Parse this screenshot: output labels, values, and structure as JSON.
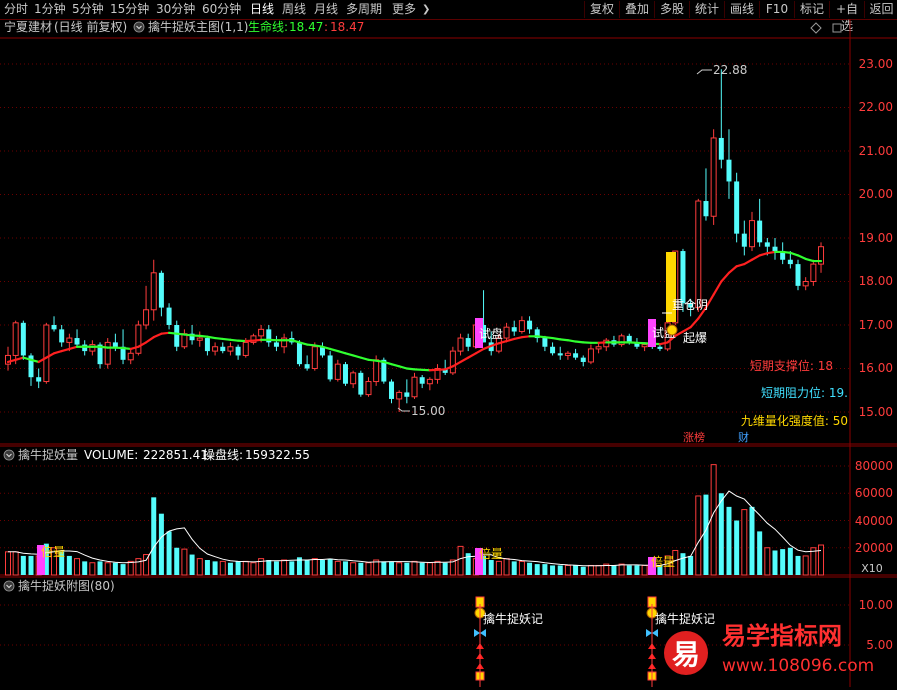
{
  "toolbar": {
    "periods": [
      "分时",
      "1分钟",
      "5分钟",
      "15分钟",
      "30分钟",
      "60分钟",
      "日线",
      "周线",
      "月线",
      "多周期",
      "更多"
    ],
    "active_period": "日线",
    "more_arrow": "❯",
    "buttons": [
      "复权",
      "叠加",
      "多股",
      "统计",
      "画线",
      "F10",
      "标记",
      "+自选",
      "返回"
    ]
  },
  "main_panel": {
    "stock_name": "宁夏建材",
    "period_desc": "(日线 前复权)",
    "indicator_name": "擒牛捉妖主图(1,1)",
    "life_line_label": "生命线:",
    "life_line_value_1": "18.47",
    "life_line_value_2": "18.47",
    "high_label": "22.88",
    "low_label": "15.00",
    "right_labels": [
      {
        "text": "短期支撑位:  18",
        "color": "#ff3c3c"
      },
      {
        "text": "短期阻力位:  19.",
        "color": "#40e0ff"
      },
      {
        "text": "九维量化强度值:  50",
        "color": "#ffd700"
      }
    ],
    "annotations": [
      "试盘",
      "试盘",
      "重仓阴",
      "起爆"
    ],
    "tags": [
      "涨榜",
      "财"
    ],
    "y_ticks": [
      "23.00",
      "22.00",
      "21.00",
      "20.00",
      "19.00",
      "18.00",
      "17.00",
      "16.00",
      "15.00"
    ],
    "icons": [
      "diamond-icon",
      "expand-icon"
    ]
  },
  "volume_panel": {
    "title": "擒牛捉妖量",
    "volume_label": "VOLUME:",
    "volume_value": "222851.41",
    "line_label": "操盘线:",
    "line_value": "159322.55",
    "y_ticks": [
      "80000",
      "60000",
      "40000",
      "20000"
    ],
    "unit": "X10",
    "markers": [
      "倍量",
      "倍量",
      "倍量"
    ]
  },
  "sub_panel": {
    "title": "擒牛捉妖附图(80)",
    "y_ticks": [
      "10.00",
      "5.00"
    ],
    "labels": [
      "擒牛捉妖记",
      "擒牛捉妖记"
    ]
  },
  "watermark": {
    "brand": "易学指标网",
    "url": "www.108096.com",
    "logo_char": "易"
  },
  "colors": {
    "up": "#ff3c3c",
    "down": "#54fcfc",
    "grid": "#8b0000",
    "life_up": "#ff2020",
    "life_down": "#30ff30",
    "highlight": "#ff44ff",
    "gold": "#ffd700"
  },
  "chart_data": {
    "type": "candlestick",
    "price_ylim": [
      14.6,
      23.4
    ],
    "volume_ylim": [
      0,
      90000
    ],
    "candles": [
      [
        16.1,
        16.5,
        15.95,
        16.3
      ],
      [
        16.3,
        17.1,
        16.1,
        17.05
      ],
      [
        17.05,
        17.1,
        16.2,
        16.3
      ],
      [
        16.3,
        16.35,
        15.6,
        15.8
      ],
      [
        15.8,
        16.0,
        15.55,
        15.7
      ],
      [
        15.7,
        17.05,
        15.65,
        17.0
      ],
      [
        17.0,
        17.2,
        16.85,
        16.9
      ],
      [
        16.9,
        17.0,
        16.5,
        16.6
      ],
      [
        16.6,
        16.8,
        16.4,
        16.7
      ],
      [
        16.7,
        16.9,
        16.5,
        16.55
      ],
      [
        16.55,
        16.65,
        16.3,
        16.4
      ],
      [
        16.4,
        16.65,
        16.3,
        16.55
      ],
      [
        16.55,
        16.6,
        16.0,
        16.1
      ],
      [
        16.1,
        16.7,
        16.0,
        16.6
      ],
      [
        16.6,
        16.8,
        16.4,
        16.5
      ],
      [
        16.5,
        16.9,
        16.1,
        16.2
      ],
      [
        16.2,
        16.45,
        16.1,
        16.35
      ],
      [
        16.35,
        17.1,
        16.3,
        17.0
      ],
      [
        17.0,
        17.9,
        16.9,
        17.35
      ],
      [
        17.35,
        18.5,
        17.1,
        18.2
      ],
      [
        18.2,
        18.25,
        17.2,
        17.4
      ],
      [
        17.4,
        17.5,
        16.9,
        17.0
      ],
      [
        17.0,
        17.1,
        16.4,
        16.5
      ],
      [
        16.5,
        16.9,
        16.45,
        16.8
      ],
      [
        16.8,
        17.0,
        16.55,
        16.65
      ],
      [
        16.65,
        16.85,
        16.5,
        16.7
      ],
      [
        16.7,
        16.75,
        16.3,
        16.4
      ],
      [
        16.4,
        16.6,
        16.3,
        16.5
      ],
      [
        16.5,
        16.6,
        16.35,
        16.4
      ],
      [
        16.4,
        16.6,
        16.3,
        16.5
      ],
      [
        16.5,
        16.55,
        16.2,
        16.3
      ],
      [
        16.3,
        16.7,
        16.25,
        16.6
      ],
      [
        16.6,
        16.8,
        16.55,
        16.75
      ],
      [
        16.75,
        17.0,
        16.6,
        16.9
      ],
      [
        16.9,
        17.0,
        16.5,
        16.6
      ],
      [
        16.6,
        16.75,
        16.4,
        16.5
      ],
      [
        16.5,
        16.8,
        16.35,
        16.7
      ],
      [
        16.7,
        16.85,
        16.55,
        16.6
      ],
      [
        16.6,
        16.65,
        16.05,
        16.1
      ],
      [
        16.1,
        16.3,
        15.95,
        16.0
      ],
      [
        16.0,
        16.6,
        15.95,
        16.5
      ],
      [
        16.5,
        16.6,
        16.25,
        16.3
      ],
      [
        16.3,
        16.4,
        15.7,
        15.75
      ],
      [
        15.75,
        16.2,
        15.7,
        16.1
      ],
      [
        16.1,
        16.15,
        15.6,
        15.65
      ],
      [
        15.65,
        15.95,
        15.55,
        15.9
      ],
      [
        15.9,
        15.95,
        15.35,
        15.4
      ],
      [
        15.4,
        15.8,
        15.35,
        15.7
      ],
      [
        15.7,
        16.3,
        15.6,
        16.2
      ],
      [
        16.2,
        16.25,
        15.65,
        15.7
      ],
      [
        15.7,
        15.75,
        15.2,
        15.3
      ],
      [
        15.3,
        15.5,
        15.0,
        15.45
      ],
      [
        15.45,
        15.75,
        15.2,
        15.35
      ],
      [
        15.35,
        15.9,
        15.3,
        15.8
      ],
      [
        15.8,
        15.85,
        15.55,
        15.65
      ],
      [
        15.65,
        15.8,
        15.5,
        15.75
      ],
      [
        15.75,
        16.1,
        15.65,
        16.0
      ],
      [
        16.0,
        16.2,
        15.85,
        15.9
      ],
      [
        15.9,
        16.5,
        15.85,
        16.4
      ],
      [
        16.4,
        16.8,
        16.3,
        16.7
      ],
      [
        16.7,
        16.8,
        16.4,
        16.5
      ],
      [
        16.5,
        17.1,
        16.45,
        17.0
      ],
      [
        17.0,
        17.8,
        16.6,
        16.6
      ],
      [
        16.6,
        16.85,
        16.3,
        16.4
      ],
      [
        16.4,
        16.8,
        16.35,
        16.7
      ],
      [
        16.7,
        17.05,
        16.6,
        16.95
      ],
      [
        16.95,
        17.1,
        16.75,
        16.85
      ],
      [
        16.85,
        17.2,
        16.8,
        17.1
      ],
      [
        17.1,
        17.2,
        16.8,
        16.9
      ],
      [
        16.9,
        16.95,
        16.6,
        16.7
      ],
      [
        16.7,
        16.75,
        16.4,
        16.5
      ],
      [
        16.5,
        16.6,
        16.3,
        16.35
      ],
      [
        16.35,
        16.5,
        16.2,
        16.3
      ],
      [
        16.3,
        16.4,
        16.2,
        16.35
      ],
      [
        16.35,
        16.45,
        16.2,
        16.25
      ],
      [
        16.25,
        16.3,
        16.05,
        16.15
      ],
      [
        16.15,
        16.55,
        16.1,
        16.45
      ],
      [
        16.45,
        16.6,
        16.35,
        16.5
      ],
      [
        16.5,
        16.7,
        16.4,
        16.65
      ],
      [
        16.65,
        16.75,
        16.5,
        16.55
      ],
      [
        16.55,
        16.8,
        16.5,
        16.75
      ],
      [
        16.75,
        16.8,
        16.55,
        16.6
      ],
      [
        16.6,
        16.7,
        16.45,
        16.5
      ],
      [
        16.5,
        16.6,
        16.4,
        16.55
      ],
      [
        16.55,
        16.6,
        16.45,
        16.5
      ],
      [
        16.5,
        16.55,
        16.4,
        16.45
      ],
      [
        16.45,
        17.1,
        16.4,
        17.05
      ],
      [
        17.05,
        18.7,
        17.0,
        18.7
      ],
      [
        18.7,
        18.75,
        17.3,
        17.5
      ],
      [
        17.5,
        17.6,
        17.2,
        17.4
      ],
      [
        17.4,
        19.9,
        17.3,
        19.85
      ],
      [
        19.85,
        20.6,
        19.4,
        19.5
      ],
      [
        19.5,
        21.5,
        19.3,
        21.3
      ],
      [
        21.3,
        22.88,
        20.6,
        20.8
      ],
      [
        20.8,
        21.5,
        19.9,
        20.3
      ],
      [
        20.3,
        20.5,
        18.9,
        19.1
      ],
      [
        19.1,
        19.4,
        18.6,
        18.8
      ],
      [
        18.8,
        19.6,
        18.7,
        19.4
      ],
      [
        19.4,
        19.9,
        18.8,
        18.9
      ],
      [
        18.9,
        19.0,
        18.6,
        18.8
      ],
      [
        18.8,
        19.0,
        18.5,
        18.7
      ],
      [
        18.7,
        18.9,
        18.4,
        18.5
      ],
      [
        18.5,
        18.7,
        18.3,
        18.4
      ],
      [
        18.4,
        18.5,
        17.8,
        17.9
      ],
      [
        17.9,
        18.1,
        17.8,
        18.0
      ],
      [
        18.0,
        18.5,
        17.9,
        18.4
      ],
      [
        18.4,
        18.9,
        18.2,
        18.8
      ]
    ],
    "life_line": [
      16.15,
      16.2,
      16.25,
      16.2,
      16.15,
      16.25,
      16.35,
      16.4,
      16.45,
      16.5,
      16.5,
      16.5,
      16.5,
      16.48,
      16.48,
      16.47,
      16.45,
      16.5,
      16.6,
      16.72,
      16.8,
      16.82,
      16.8,
      16.78,
      16.76,
      16.75,
      16.73,
      16.7,
      16.68,
      16.66,
      16.64,
      16.63,
      16.64,
      16.66,
      16.66,
      16.65,
      16.65,
      16.65,
      16.6,
      16.55,
      16.53,
      16.5,
      16.45,
      16.4,
      16.35,
      16.3,
      16.25,
      16.2,
      16.18,
      16.15,
      16.1,
      16.05,
      16.0,
      15.98,
      15.97,
      15.96,
      15.97,
      15.98,
      16.05,
      16.15,
      16.25,
      16.35,
      16.45,
      16.52,
      16.58,
      16.63,
      16.68,
      16.72,
      16.74,
      16.74,
      16.72,
      16.7,
      16.67,
      16.65,
      16.62,
      16.6,
      16.59,
      16.59,
      16.6,
      16.6,
      16.6,
      16.6,
      16.59,
      16.58,
      16.57,
      16.56,
      16.6,
      16.75,
      16.85,
      16.95,
      17.15,
      17.4,
      17.7,
      18.0,
      18.2,
      18.35,
      18.4,
      18.5,
      18.6,
      18.65,
      18.68,
      18.68,
      18.66,
      18.6,
      18.52,
      18.47,
      18.47
    ],
    "volumes": [
      [
        17000,
        1
      ],
      [
        17000,
        1
      ],
      [
        14000,
        0
      ],
      [
        14000,
        0
      ],
      [
        14000,
        1
      ],
      [
        23000,
        0
      ],
      [
        20000,
        1
      ],
      [
        17000,
        0
      ],
      [
        14000,
        0
      ],
      [
        12000,
        1
      ],
      [
        10000,
        0
      ],
      [
        9000,
        1
      ],
      [
        10000,
        0
      ],
      [
        9000,
        1
      ],
      [
        9000,
        0
      ],
      [
        8000,
        0
      ],
      [
        10000,
        1
      ],
      [
        12000,
        1
      ],
      [
        15000,
        1
      ],
      [
        57000,
        0
      ],
      [
        45000,
        0
      ],
      [
        32000,
        0
      ],
      [
        20000,
        0
      ],
      [
        19000,
        1
      ],
      [
        15000,
        0
      ],
      [
        12000,
        1
      ],
      [
        11000,
        0
      ],
      [
        10000,
        0
      ],
      [
        10000,
        1
      ],
      [
        9000,
        0
      ],
      [
        10000,
        0
      ],
      [
        10000,
        1
      ],
      [
        9000,
        1
      ],
      [
        12000,
        1
      ],
      [
        11000,
        0
      ],
      [
        10000,
        0
      ],
      [
        11000,
        1
      ],
      [
        10000,
        0
      ],
      [
        13000,
        0
      ],
      [
        11000,
        0
      ],
      [
        12000,
        1
      ],
      [
        11000,
        0
      ],
      [
        12000,
        0
      ],
      [
        10000,
        1
      ],
      [
        10000,
        0
      ],
      [
        9000,
        1
      ],
      [
        9000,
        0
      ],
      [
        9000,
        1
      ],
      [
        11000,
        1
      ],
      [
        10000,
        0
      ],
      [
        10000,
        0
      ],
      [
        9000,
        1
      ],
      [
        9000,
        0
      ],
      [
        10000,
        1
      ],
      [
        9000,
        0
      ],
      [
        9000,
        1
      ],
      [
        10000,
        1
      ],
      [
        9000,
        0
      ],
      [
        11000,
        1
      ],
      [
        21000,
        1
      ],
      [
        16000,
        0
      ],
      [
        12000,
        1
      ],
      [
        14000,
        0
      ],
      [
        11000,
        0
      ],
      [
        10000,
        1
      ],
      [
        12000,
        1
      ],
      [
        10000,
        0
      ],
      [
        10000,
        1
      ],
      [
        9000,
        0
      ],
      [
        8000,
        0
      ],
      [
        8000,
        0
      ],
      [
        7000,
        0
      ],
      [
        7000,
        0
      ],
      [
        7000,
        1
      ],
      [
        7000,
        0
      ],
      [
        6000,
        0
      ],
      [
        7000,
        1
      ],
      [
        7000,
        1
      ],
      [
        8000,
        1
      ],
      [
        7000,
        0
      ],
      [
        8000,
        1
      ],
      [
        7000,
        0
      ],
      [
        7000,
        0
      ],
      [
        7000,
        1
      ],
      [
        7000,
        0
      ],
      [
        7000,
        0
      ],
      [
        14000,
        1
      ],
      [
        18000,
        1
      ],
      [
        16000,
        0
      ],
      [
        14000,
        0
      ],
      [
        58000,
        1
      ],
      [
        59000,
        0
      ],
      [
        81000,
        1
      ],
      [
        60000,
        0
      ],
      [
        50000,
        0
      ],
      [
        40000,
        0
      ],
      [
        48000,
        1
      ],
      [
        50000,
        0
      ],
      [
        32000,
        0
      ],
      [
        20000,
        1
      ],
      [
        18000,
        0
      ],
      [
        19000,
        0
      ],
      [
        20000,
        0
      ],
      [
        14000,
        0
      ],
      [
        14000,
        1
      ],
      [
        20000,
        1
      ],
      [
        22000,
        1
      ]
    ]
  }
}
